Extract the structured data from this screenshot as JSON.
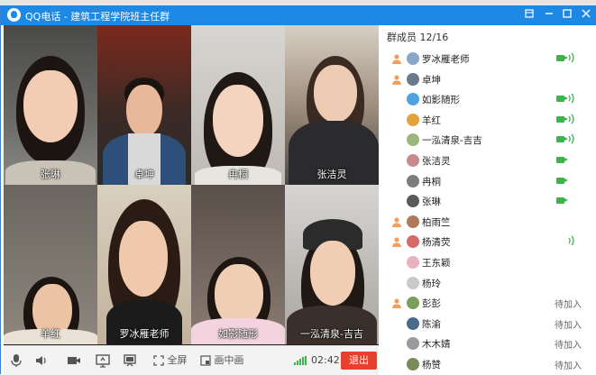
{
  "window": {
    "title": "QQ电话 - 建筑工程学院班主任群"
  },
  "video_tiles": [
    {
      "name": "张琳"
    },
    {
      "name": "卓坤"
    },
    {
      "name": "冉桐"
    },
    {
      "name": "张洁灵"
    },
    {
      "name": "羊红"
    },
    {
      "name": "罗冰雁老师"
    },
    {
      "name": "如影随形"
    },
    {
      "name": "一泓清泉-吉吉"
    }
  ],
  "controls": {
    "fullscreen_label": "全屏",
    "pip_label": "画中画",
    "timer": "02:42",
    "exit_label": "退出"
  },
  "sidebar": {
    "header": "群成员 12/16",
    "members": [
      {
        "name": "罗冰雁老师",
        "host": true,
        "cam": true,
        "vol": true,
        "status": ""
      },
      {
        "name": "卓坤",
        "host": true,
        "cam": false,
        "vol": false,
        "status": ""
      },
      {
        "name": "如影随形",
        "host": false,
        "cam": true,
        "vol": true,
        "status": ""
      },
      {
        "name": "羊红",
        "host": false,
        "cam": true,
        "vol": true,
        "status": ""
      },
      {
        "name": "一泓清泉-吉吉",
        "host": false,
        "cam": true,
        "vol": true,
        "status": ""
      },
      {
        "name": "张洁灵",
        "host": false,
        "cam": true,
        "vol": false,
        "status": ""
      },
      {
        "name": "冉桐",
        "host": false,
        "cam": true,
        "vol": false,
        "status": ""
      },
      {
        "name": "张琳",
        "host": false,
        "cam": true,
        "vol": false,
        "status": ""
      },
      {
        "name": "柏雨竺",
        "host": true,
        "cam": false,
        "vol": false,
        "status": ""
      },
      {
        "name": "杨清荧",
        "host": true,
        "cam": false,
        "vol": true,
        "status": ""
      },
      {
        "name": "王东颖",
        "host": false,
        "cam": false,
        "vol": false,
        "status": ""
      },
      {
        "name": "杨玲",
        "host": false,
        "cam": false,
        "vol": false,
        "status": ""
      },
      {
        "name": "彭彭",
        "host": true,
        "cam": false,
        "vol": false,
        "status": "待加入"
      },
      {
        "name": "陈渝",
        "host": false,
        "cam": false,
        "vol": false,
        "status": "待加入"
      },
      {
        "name": "木木婧",
        "host": false,
        "cam": false,
        "vol": false,
        "status": "待加入"
      },
      {
        "name": "杨赞",
        "host": false,
        "cam": false,
        "vol": false,
        "status": "待加入"
      }
    ]
  },
  "colors": {
    "titlebar": "#1e88e5",
    "exit_button": "#e5412d",
    "active_green": "#3ab54a"
  }
}
